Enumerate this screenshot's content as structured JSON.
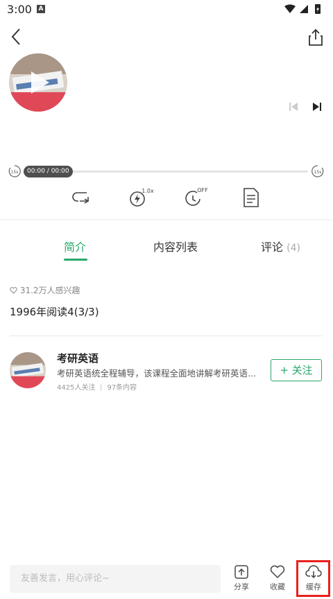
{
  "status_bar": {
    "time": "3:00",
    "notification_letter": "A"
  },
  "episode": {
    "interest_text": "31.2万人感兴趣",
    "title": "1996年阅读4(3/3)"
  },
  "player": {
    "time_display": "00:00 / 00:00",
    "rewind_label": "15s",
    "forward_label": "15s",
    "speed_label": "1.0x",
    "timer_label": "OFF"
  },
  "tabs": [
    {
      "label": "简介"
    },
    {
      "label": "内容列表"
    },
    {
      "label": "评论",
      "count": "(4)"
    }
  ],
  "course": {
    "name": "考研英语",
    "description": "考研英语统全程辅导，该课程全面地讲解考研英语...",
    "followers": "4425人关注",
    "items": "97条内容",
    "follow_label": "+ 关注"
  },
  "bottom_bar": {
    "comment_placeholder": "友善发言，用心评论~",
    "share_label": "分享",
    "favorite_label": "收藏",
    "cache_label": "缓存"
  },
  "colors": {
    "accent": "#27a86a",
    "highlight": "#e8201b"
  }
}
